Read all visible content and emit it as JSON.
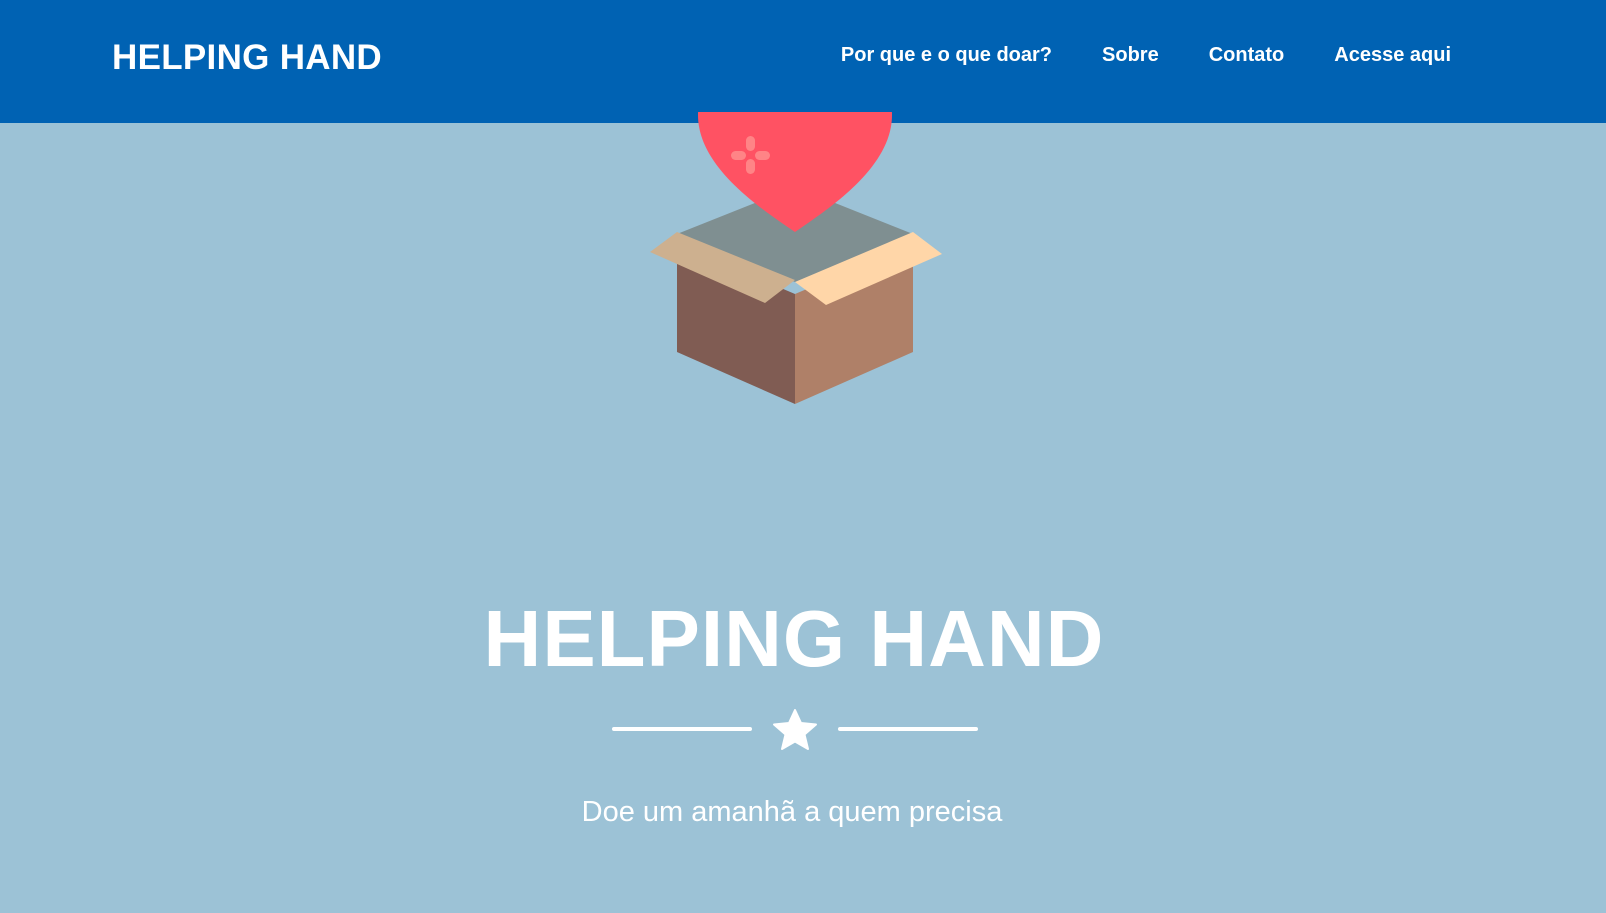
{
  "navbar": {
    "brand": "HELPING HAND",
    "links": [
      {
        "label": "Por que e o que doar?"
      },
      {
        "label": "Sobre"
      },
      {
        "label": "Contato"
      },
      {
        "label": "Acesse aqui"
      }
    ]
  },
  "masthead": {
    "icon": "heart-in-box-icon",
    "title": "HELPING HAND",
    "divider_icon": "star-icon",
    "subtitle": "Doe um amanhã a quem precisa"
  },
  "colors": {
    "navbar": "#0062b3",
    "background": "#9cc2d6",
    "heart": "#ff5263",
    "text": "#ffffff"
  }
}
